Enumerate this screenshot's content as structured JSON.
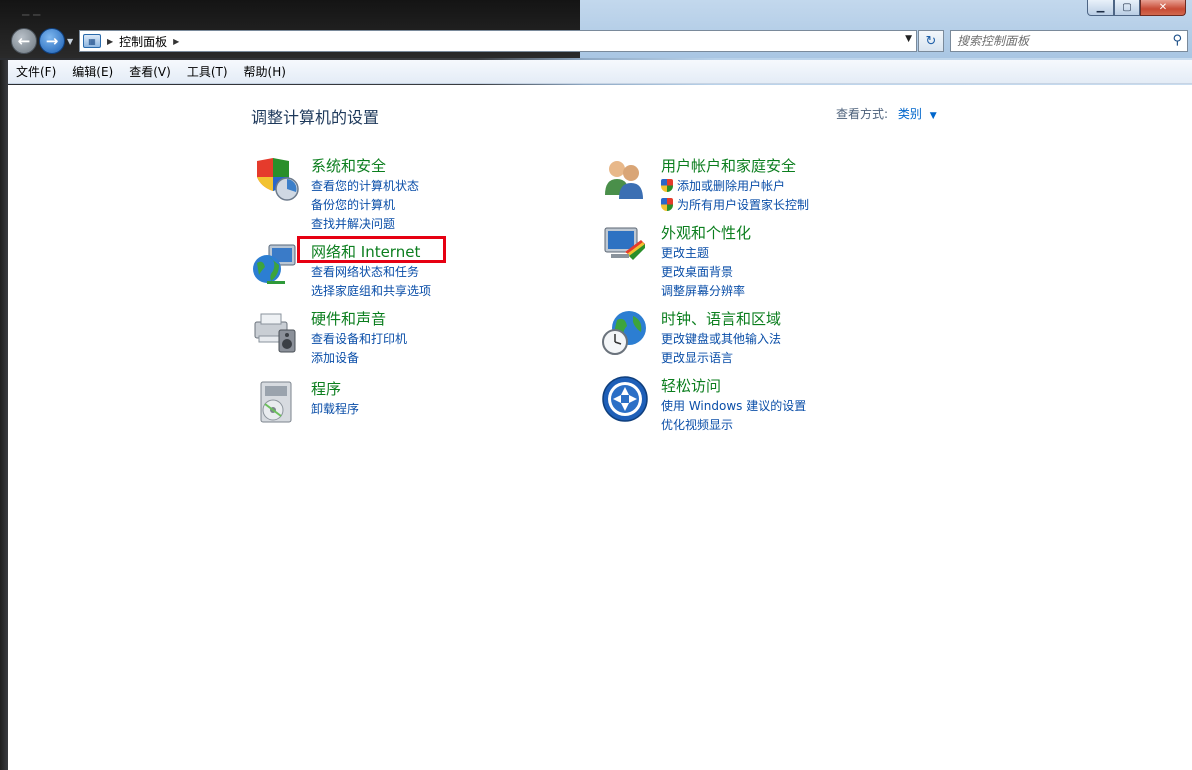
{
  "window": {
    "caption_buttons": [
      "minimize",
      "maximize",
      "close"
    ]
  },
  "address_bar": {
    "crumbs": [
      "控制面板"
    ],
    "refresh_icon": "refresh-icon"
  },
  "search": {
    "placeholder": "搜索控制面板"
  },
  "menu": {
    "items": [
      "文件(F)",
      "编辑(E)",
      "查看(V)",
      "工具(T)",
      "帮助(H)"
    ]
  },
  "content": {
    "title": "调整计算机的设置",
    "view_by_label": "查看方式:",
    "view_by_value": "类别",
    "categories": [
      {
        "title": "系统和安全",
        "icon": "system-security-icon",
        "links": [
          "查看您的计算机状态",
          "备份您的计算机",
          "查找并解决问题"
        ]
      },
      {
        "title": "网络和 Internet",
        "icon": "network-internet-icon",
        "links": [
          "查看网络状态和任务",
          "选择家庭组和共享选项"
        ]
      },
      {
        "title": "硬件和声音",
        "icon": "hardware-sound-icon",
        "links": [
          "查看设备和打印机",
          "添加设备"
        ]
      },
      {
        "title": "程序",
        "icon": "programs-icon",
        "links": [
          "卸载程序"
        ]
      },
      {
        "title": "用户帐户和家庭安全",
        "icon": "user-accounts-icon",
        "links": [
          "添加或删除用户帐户",
          "为所有用户设置家长控制"
        ]
      },
      {
        "title": "外观和个性化",
        "icon": "appearance-icon",
        "links": [
          "更改主题",
          "更改桌面背景",
          "调整屏幕分辨率"
        ]
      },
      {
        "title": "时钟、语言和区域",
        "icon": "clock-language-region-icon",
        "links": [
          "更改键盘或其他输入法",
          "更改显示语言"
        ]
      },
      {
        "title": "轻松访问",
        "icon": "ease-of-access-icon",
        "links": [
          "使用 Windows 建议的设置",
          "优化视频显示"
        ]
      }
    ]
  },
  "colors": {
    "category_title": "#0b7e1e",
    "link": "#0a4ea8",
    "highlight": "#e60012"
  }
}
